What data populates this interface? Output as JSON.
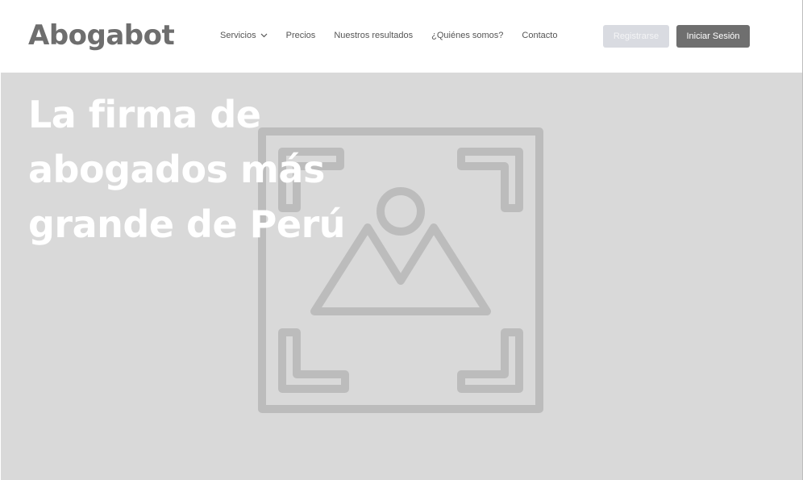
{
  "brand": {
    "name": "Abogabot"
  },
  "nav": {
    "items": [
      {
        "label": "Servicios",
        "has_dropdown": true
      },
      {
        "label": "Precios"
      },
      {
        "label": "Nuestros resultados"
      },
      {
        "label": "¿Quiénes somos?"
      },
      {
        "label": "Contacto"
      }
    ]
  },
  "actions": {
    "register_label": "Registrarse",
    "login_label": "Iniciar Sesión"
  },
  "hero": {
    "title_lines": [
      "La firma de",
      "abogados más",
      "grande de Perú"
    ],
    "image_icon": "image-placeholder-icon"
  },
  "colors": {
    "logo": "#6e6e6e",
    "hero_background": "#d9d9d9",
    "register_button": "#d9dbe1",
    "login_button": "#6f6f6f"
  }
}
